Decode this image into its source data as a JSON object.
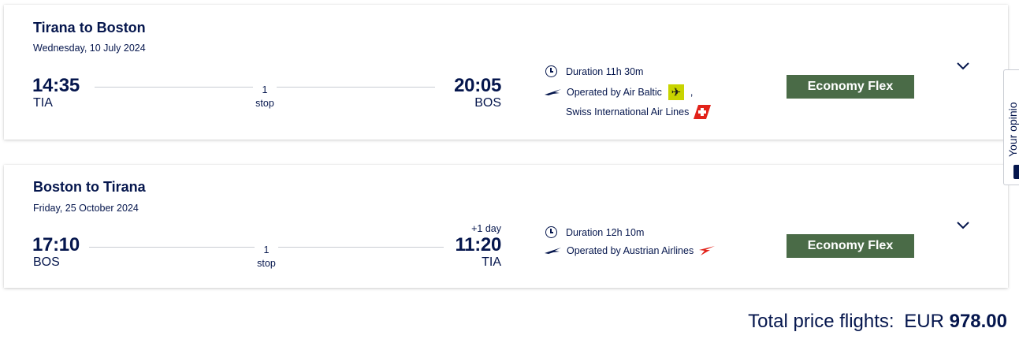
{
  "flights": [
    {
      "route": "Tirana to Boston",
      "date": "Wednesday, 10 July 2024",
      "departure_time": "14:35",
      "departure_code": "TIA",
      "arrival_time": "20:05",
      "arrival_code": "BOS",
      "stops_count": "1",
      "stops_label": "stop",
      "duration": "Duration 11h 30m",
      "operated_by": "Operated by Air Baltic",
      "operated_by_sep": ",",
      "operated_by_second": "Swiss International Air Lines",
      "fare": "Economy Flex",
      "icons": {
        "clock": "clock-icon",
        "crane": "lufthansa-crane-icon",
        "airline_1": "airbaltic-logo-icon",
        "airline_2": "swiss-logo-icon",
        "expand": "chevron-down-icon"
      }
    },
    {
      "route": "Boston to Tirana",
      "date": "Friday, 25 October 2024",
      "departure_time": "17:10",
      "departure_code": "BOS",
      "arrival_time": "11:20",
      "arrival_code": "TIA",
      "day_offset": "+1 day",
      "stops_count": "1",
      "stops_label": "stop",
      "duration": "Duration 12h 10m",
      "operated_by": "Operated by Austrian Airlines",
      "fare": "Economy Flex",
      "icons": {
        "clock": "clock-icon",
        "crane": "lufthansa-crane-icon",
        "airline_1": "austrian-logo-icon",
        "expand": "chevron-down-icon"
      }
    }
  ],
  "total": {
    "label": "Total price flights:",
    "currency": "EUR",
    "amount": "978.00"
  },
  "side_tab": {
    "label": "Your opinion"
  },
  "colors": {
    "text": "#05164d",
    "fare_button": "#4a6b47",
    "airbaltic": "#c8d400",
    "swiss": "#e2231a",
    "austrian": "#e2231a"
  }
}
